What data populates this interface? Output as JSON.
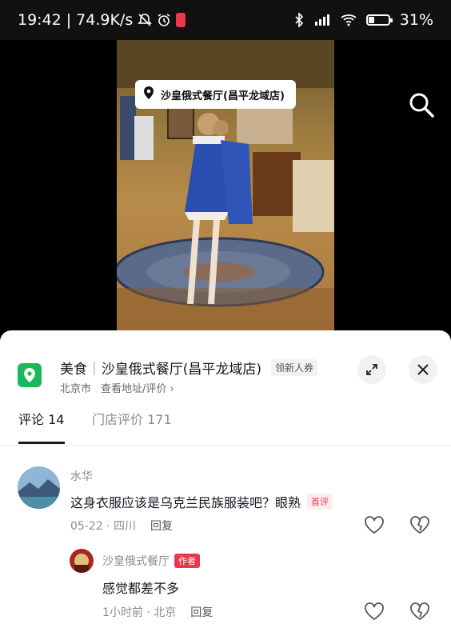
{
  "status_bar": {
    "time": "19:42",
    "speed": "74.9K/s",
    "battery": "31%",
    "battery_level": 0.31
  },
  "video": {
    "location_label": "沙皇俄式餐厅(昌平龙域店)"
  },
  "shop": {
    "category": "美食",
    "name": "沙皇俄式餐厅(昌平龙域店)",
    "coupon": "领新人券",
    "city": "北京市",
    "address_link": "查看地址/评价"
  },
  "tabs": [
    {
      "label": "评论 14"
    },
    {
      "label": "门店评价 171"
    }
  ],
  "comments": [
    {
      "user": "水华",
      "text": "这身衣服应该是乌克兰民族服装吧？眼熟",
      "tag": "首评",
      "date": "05-22",
      "region": "四川",
      "reply": "回复"
    },
    {
      "user": "沙皇俄式餐厅",
      "tag": "作者",
      "text": "感觉都差不多",
      "date": "1小时前",
      "region": "北京",
      "reply": "回复"
    }
  ],
  "colors": {
    "accent_red": "#e8394b",
    "shop_green": "#19b85a"
  }
}
